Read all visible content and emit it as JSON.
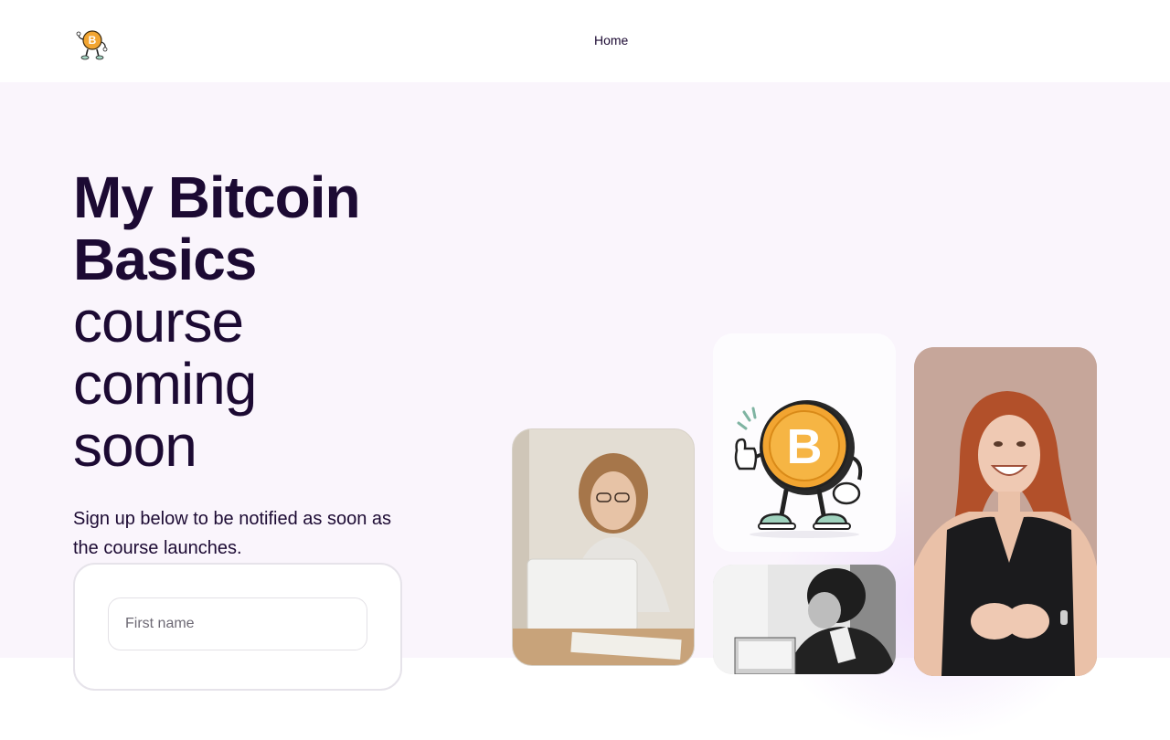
{
  "header": {
    "nav": {
      "home_label": "Home"
    }
  },
  "hero": {
    "title_bold_line1": "My Bitcoin",
    "title_bold_line2": "Basics",
    "title_light_line1": "course",
    "title_light_line2": "coming",
    "title_light_line3": "soon",
    "subtitle": "Sign up below to be notified as soon as the course launches.",
    "form": {
      "first_name_placeholder": "First name",
      "first_name_value": ""
    }
  },
  "images": [
    {
      "name": "woman-with-laptop-photo"
    },
    {
      "name": "bitcoin-mascot-illustration"
    },
    {
      "name": "person-with-laptop-bw-photo"
    },
    {
      "name": "smiling-woman-photo"
    }
  ],
  "colors": {
    "text": "#1c0a33",
    "hero_background": "#faf5fc",
    "coin": "#f2a531",
    "card_border": "#e6e3ea"
  }
}
